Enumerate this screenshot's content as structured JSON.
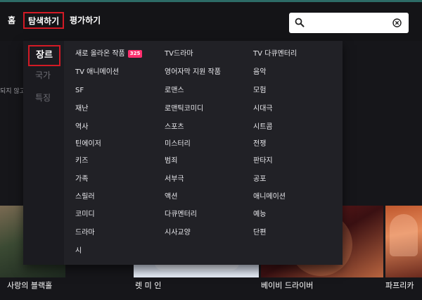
{
  "nav": {
    "home": "홈",
    "explore": "탐색하기",
    "rate": "평가하기"
  },
  "search": {
    "value": "",
    "placeholder": ""
  },
  "background": {
    "partial_text": "되지 않고",
    "posters": [
      {
        "title": "사랑의 블랙홀"
      },
      {
        "title": "렛 미 인"
      },
      {
        "title": "베이비 드라이버"
      },
      {
        "title": "파프리카"
      }
    ]
  },
  "dropdown": {
    "side_tabs": [
      "장르",
      "국가",
      "특징"
    ],
    "new_badge": "325",
    "genres": [
      [
        "새로 올라온 작품",
        "TV 애니메이션",
        "SF",
        "재난",
        "역사",
        "틴에이저",
        "키즈",
        "가족",
        "스릴러",
        "코미디",
        "드라마",
        "시"
      ],
      [
        "TV드라마",
        "영어자막 지원 작품",
        "로맨스",
        "로맨틱코미디",
        "스포츠",
        "미스터리",
        "범죄",
        "서부극",
        "액션",
        "다큐멘터리",
        "시사교양"
      ],
      [
        "TV 다큐멘터리",
        "음악",
        "모험",
        "시대극",
        "시트콤",
        "전쟁",
        "판타지",
        "공포",
        "애니메이션",
        "예능",
        "단편"
      ]
    ]
  },
  "colors": {
    "highlight": "#d21a25",
    "badge": "#ff2f6e",
    "menu_bg": "#212126"
  }
}
